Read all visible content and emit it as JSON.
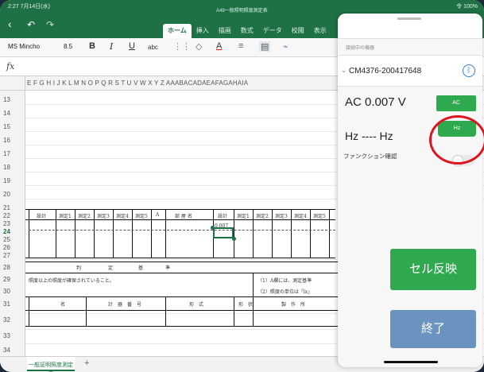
{
  "status_bar": {
    "time": "2:27  7月14日(水)",
    "right": "令 100%"
  },
  "app": {
    "document_title": "A49一般照明照度測定表"
  },
  "ribbon": {
    "tabs": [
      "ホーム",
      "挿入",
      "描画",
      "数式",
      "データ",
      "校閲",
      "表示"
    ],
    "active_tab": "ホーム"
  },
  "toolbar": {
    "font_name": "MS Mincho",
    "font_size": "8.5",
    "bold": "B",
    "italic": "I",
    "underline": "U",
    "strike": "abc",
    "text_color_letter": "A"
  },
  "formula_bar": {
    "fx": "fx"
  },
  "columns": "E F G H I J K L M N O P Q R S T U V W X Y Z AAABACADAEAFAGAHAIA",
  "rows": [
    "13",
    "14",
    "15",
    "16",
    "17",
    "18",
    "19",
    "20",
    "21",
    "22",
    "23",
    "24",
    "25",
    "26",
    "27",
    "28",
    "29",
    "30",
    "31",
    "32",
    "33",
    "34"
  ],
  "sheet": {
    "row22_headers": [
      "設計",
      "測定1",
      "測定2",
      "測定3",
      "測定4",
      "測定5",
      "A",
      "部 屋 名",
      "設計",
      "測定1",
      "測定2",
      "測定3",
      "測定4",
      "測定5"
    ],
    "active_cell_value": "0.007",
    "row28": [
      "判",
      "定",
      "基",
      "準"
    ],
    "row29_left": "照度以上の照度が確保されていること。",
    "row29_right": "（1）A欄には、測定基準",
    "row30_right": "（2）照度の単位は「lx」",
    "row31": [
      "名",
      "計　器　番　号",
      "形　式",
      "形　状",
      "製　作　所"
    ]
  },
  "sheet_tabs": {
    "tab_label": "一般証明照度測定表",
    "add": "+"
  },
  "panel": {
    "section_label": "接続中の機器",
    "device_name": "CM4376-200417648",
    "reading_ac": "AC 0.007 V",
    "ac_button": "AC",
    "reading_hz": "Hz ---- Hz",
    "hz_button": "Hz",
    "function_label": "ファンクション確認",
    "reflect_button": "セル反映",
    "end_button": "終了"
  },
  "colors": {
    "excel_green": "#1e7145",
    "button_green": "#2ea94d",
    "end_blue": "#6b93bf",
    "annotation_red": "#e0141e"
  }
}
